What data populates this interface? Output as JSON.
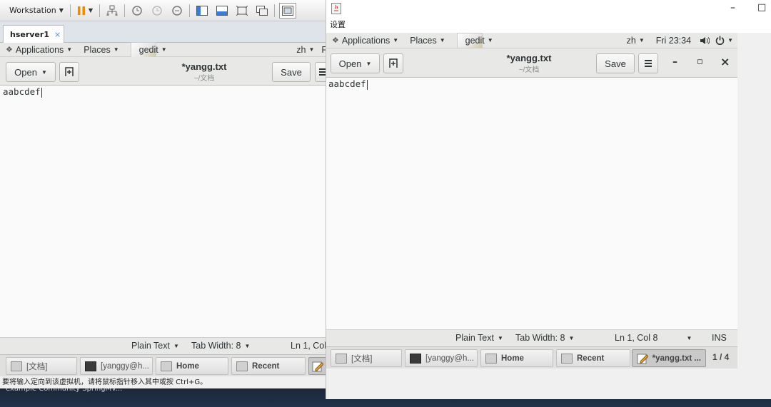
{
  "vmware": {
    "menu_label": "Workstation",
    "tab_label": "hserver1",
    "tab_close": "×",
    "hint": "要将输入定向到该虚拟机，请将鼠标指针移入其中或按 Ctrl+G。"
  },
  "desktop": {
    "labels": "example     Community   SpringMV..."
  },
  "right_window": {
    "caption": "设置",
    "minimize": "–",
    "maximize": "□"
  },
  "gnome": {
    "applications": "Applications",
    "places": "Places",
    "app_name": "gedit",
    "lang": "zh",
    "clock": "Fri 23:34",
    "left_lang": "zh",
    "left_trailing": "F"
  },
  "gedit": {
    "open_label": "Open",
    "save_label": "Save",
    "title": "*yangg.txt",
    "subtitle": "~/文档",
    "content": "aabcdef",
    "minimize": "–",
    "maximize": "▫",
    "close": "×"
  },
  "status": {
    "syntax": "Plain Text",
    "tab_width": "Tab Width: 8",
    "position": "Ln 1, Col 8",
    "left_position": "Ln 1, Col",
    "mode": "INS"
  },
  "taskbar": {
    "items": [
      "[文档]",
      "[yanggy@h...",
      "Home",
      "Recent",
      "*yangg.txt ..."
    ],
    "left_items": [
      "[文档]",
      "[yanggy@h...",
      "Home",
      "Recent"
    ],
    "workspace": "1 / 4"
  }
}
